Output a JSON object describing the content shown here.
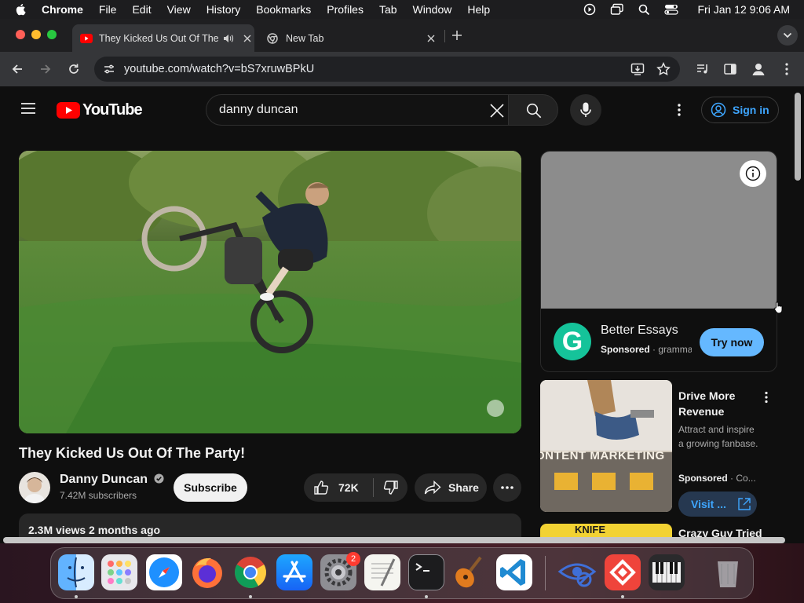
{
  "menubar": {
    "app": "Chrome",
    "items": [
      "File",
      "Edit",
      "View",
      "History",
      "Bookmarks",
      "Profiles",
      "Tab",
      "Window",
      "Help"
    ],
    "clock": "Fri Jan 12  9:06 AM"
  },
  "tabs": [
    {
      "title": "They Kicked Us Out Of The Party!"
    },
    {
      "title": "New Tab"
    }
  ],
  "omnibox": {
    "url": "youtube.com/watch?v=bS7xruwBPkU"
  },
  "youtube": {
    "logo_text": "YouTube",
    "search_value": "danny duncan",
    "sign_in": "Sign in"
  },
  "video": {
    "title": "They Kicked Us Out Of The Party!",
    "channel": "Danny Duncan",
    "subscribers": "7.42M subscribers",
    "subscribe_label": "Subscribe",
    "likes": "72K",
    "share_label": "Share",
    "meta": "2.3M views  2 months ago"
  },
  "ad": {
    "brand": "Better Essays",
    "sponsored": "Sponsored",
    "domain": "gramma",
    "cta": "Try now",
    "logo_letter": "G",
    "accent": "#15c39a"
  },
  "recommendations": [
    {
      "title": "Drive More Revenue",
      "desc": "Attract and inspire a growing fanbase.",
      "sponsored": "Sponsored",
      "domain": "Co...",
      "cta": "Visit ...",
      "thumb_text": "ONTENT MARKETING"
    },
    {
      "title": "Crazy Guy Tried",
      "thumb_text": "KNIFE"
    }
  ],
  "dock": {
    "badge": "2",
    "apps": [
      "finder-icon",
      "launchpad-icon",
      "safari-icon",
      "firefox-icon",
      "chrome-icon",
      "app-store-icon",
      "system-settings-icon",
      "textedit-icon",
      "terminal-icon",
      "garageband-icon",
      "vscode-icon",
      "privacy-icon",
      "anydesk-icon",
      "piano-icon",
      "trash-icon"
    ]
  },
  "colors": {
    "youtube_red": "#ff0000",
    "link_blue": "#3ea6ff",
    "ad_button": "#65b8ff"
  }
}
